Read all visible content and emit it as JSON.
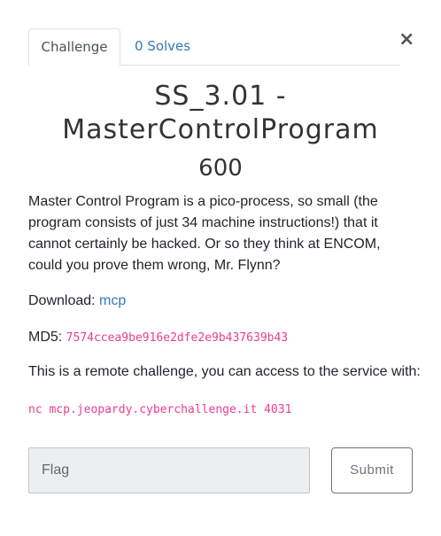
{
  "tabs": {
    "challenge": "Challenge",
    "solves": "0 Solves"
  },
  "close_icon": "×",
  "challenge": {
    "name_line1": "SS_3.01 -",
    "name_line2": "MasterControlProgram",
    "value": "600",
    "description": "Master Control Program is a pico-process, so small (the program consists of just 34 machine instructions!) that it cannot certainly be hacked. Or so they think at ENCOM, could you prove them wrong, Mr. Flynn?",
    "download_label": "Download: ",
    "download_link": "mcp",
    "md5_label": "MD5: ",
    "md5_value": "7574ccea9be916e2dfe2e9b437639b43",
    "remote_text": "This is a remote challenge, you can access to the service with:",
    "command": "nc mcp.jeopardy.cyberchallenge.it 4031"
  },
  "form": {
    "flag_placeholder": "Flag",
    "submit_label": "Submit"
  },
  "colors": {
    "link": "#337ab7",
    "code": "#e83e8c"
  }
}
